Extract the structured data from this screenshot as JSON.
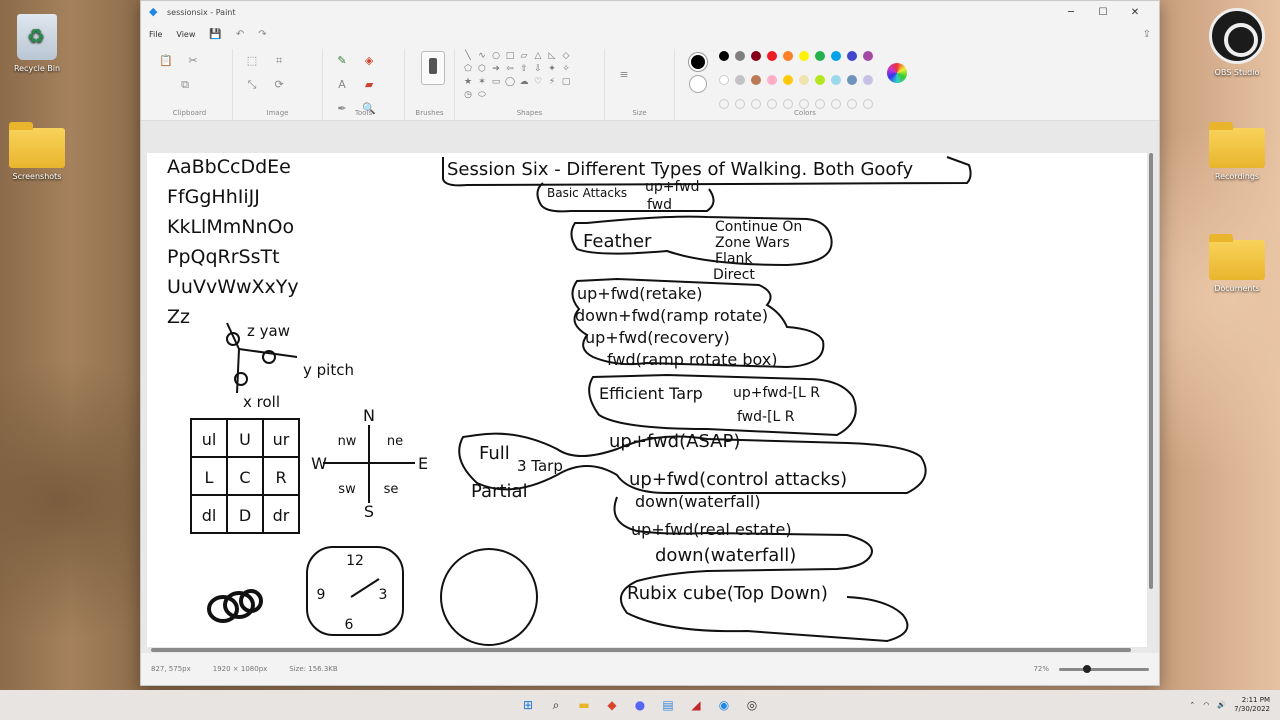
{
  "window": {
    "title": "sessionsix - Paint",
    "menus": [
      "File",
      "View"
    ]
  },
  "desktop": {
    "icons_left": [
      {
        "label": "Recycle Bin",
        "icon": "recycle-bin-icon"
      },
      {
        "label": "Screenshots",
        "icon": "folder-icon"
      }
    ],
    "icons_right": [
      {
        "label": "OBS Studio",
        "icon": "obs-icon"
      },
      {
        "label": "Recordings",
        "icon": "folder-icon"
      },
      {
        "label": "Documents",
        "icon": "folder-icon"
      }
    ]
  },
  "ribbon": {
    "groups": [
      "Clipboard",
      "Image",
      "Tools",
      "Brushes",
      "Shapes",
      "Size",
      "Colors"
    ],
    "palette_row1": [
      "#000000",
      "#7f7f7f",
      "#880015",
      "#ed1c24",
      "#ff7f27",
      "#fff200",
      "#22b14c",
      "#00a2e8",
      "#3f48cc",
      "#a349a4"
    ],
    "palette_row2": [
      "#ffffff",
      "#c3c3c3",
      "#b97a57",
      "#ffaec9",
      "#ffc90e",
      "#efe4b0",
      "#b5e61d",
      "#99d9ea",
      "#7092be",
      "#c8bfe7"
    ]
  },
  "canvas_text": {
    "alphabet": [
      "AaBbCcDdEe",
      "FfGgHhIiJJ",
      "KkLlMmNnOo",
      "PpQqRrSsTt",
      "UuVvWwXxYy",
      "Zz"
    ],
    "axes": {
      "yaw": "z yaw",
      "pitch": "y pitch",
      "roll": "x roll"
    },
    "grid": [
      "ul",
      "U",
      "ur",
      "L",
      "C",
      "R",
      "dl",
      "D",
      "dr"
    ],
    "compass": {
      "n": "N",
      "s": "S",
      "e": "E",
      "w": "W",
      "ne": "ne",
      "nw": "nw",
      "se": "se",
      "sw": "sw"
    },
    "clock": {
      "top": "12",
      "right": "3",
      "bottom": "6",
      "left": "9"
    },
    "title": "Session Six - Different Types of Walking. Both Goofy",
    "lines": {
      "basic": "Basic Attacks",
      "basic_a": "up+fwd",
      "basic_b": "fwd",
      "feather": "Feather",
      "feather_a": "Continue On",
      "feather_b": "Zone Wars",
      "feather_c": "Flank",
      "feather_d": "Direct",
      "l1": "up+fwd(retake)",
      "l2": "down+fwd(ramp rotate)",
      "l3": "up+fwd(recovery)",
      "l4": "fwd(ramp rotate box)",
      "efficient": "Efficient Tarp",
      "eff_a": "up+fwd-[L R",
      "eff_b": "fwd-[L R",
      "l5": "up+fwd(ASAP)",
      "full": "Full",
      "tarp": "3 Tarp",
      "partial": "Partial",
      "l6": "up+fwd(control attacks)",
      "l7": "down(waterfall)",
      "l8": "up+fwd(real estate)",
      "l9": "down(waterfall)",
      "l10": "Rubix cube(Top Down)"
    }
  },
  "statusbar": {
    "cursor": "827, 575px",
    "dimensions": "1920 × 1080px",
    "size": "Size: 156.3KB",
    "zoom": "72%"
  },
  "taskbar": {
    "time": "2:11 PM",
    "date": "7/30/2022"
  }
}
